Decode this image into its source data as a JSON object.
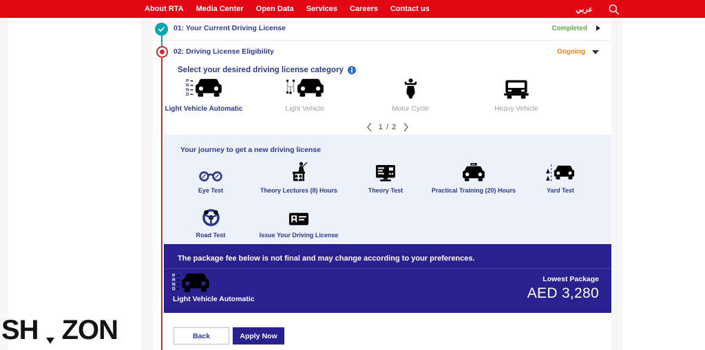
{
  "colors": {
    "brand_red": "#e30613",
    "navy_text": "#2d3a8e",
    "banner_indigo": "#2a2190",
    "journey_bg": "#edf1f9",
    "completed_green": "#67a950",
    "ongoing_orange": "#ef7f1a",
    "check_teal": "#0aa6ae",
    "timeline_red": "#d7282f",
    "inactive_gray": "#9aa0a6",
    "info_blue": "#2f6bcc"
  },
  "nav": {
    "items": [
      "About RTA",
      "Media Center",
      "Open Data",
      "Services",
      "Careers",
      "Contact us"
    ],
    "language": "عربي"
  },
  "steps": [
    {
      "label": "01: Your Current Driving License",
      "status": "Completed"
    },
    {
      "label": "02: Driving License Eligibility",
      "status": "Ongoing"
    }
  ],
  "category_section": {
    "heading": "Select your desired driving license category",
    "categories": [
      {
        "label": "Light Vehicle Automatic",
        "selected": true
      },
      {
        "label": "Light Vehicle",
        "selected": false
      },
      {
        "label": "Motor Cycle",
        "selected": false
      },
      {
        "label": "Heavy Vehicle",
        "selected": false
      }
    ],
    "pagination": {
      "label": "1 / 2"
    }
  },
  "journey": {
    "title": "Your journey to get a new driving license",
    "steps": [
      {
        "label": "Eye Test"
      },
      {
        "label": "Theory Lectures (8) Hours"
      },
      {
        "label": "Theory Test"
      },
      {
        "label": "Practical Training (20) Hours"
      },
      {
        "label": "Yard Test"
      },
      {
        "label": "Road Test"
      },
      {
        "label": "Issue Your Driving License"
      }
    ]
  },
  "package_banner": {
    "notice": "The package fee below is not final and may change according to your preferences.",
    "category_label": "Light Vehicle Automatic",
    "package_label": "Lowest Package",
    "price": "AED 3,280"
  },
  "actions": {
    "back_label": "Back",
    "apply_label": "Apply Now"
  },
  "watermark": {
    "left": "SH",
    "right": "ZON"
  },
  "icons": [
    "search-icon",
    "info-icon",
    "check-icon",
    "radio-current-icon",
    "arrow-right-icon",
    "arrow-down-icon",
    "chevron-left-icon",
    "chevron-right-icon",
    "car-automatic-icon",
    "car-manual-icon",
    "motorcycle-icon",
    "truck-icon",
    "glasses-icon",
    "lecture-icon",
    "monitor-icon",
    "taxi-icon",
    "yard-cones-icon",
    "steering-wheel-icon",
    "id-card-icon",
    "location-pin-icon"
  ]
}
